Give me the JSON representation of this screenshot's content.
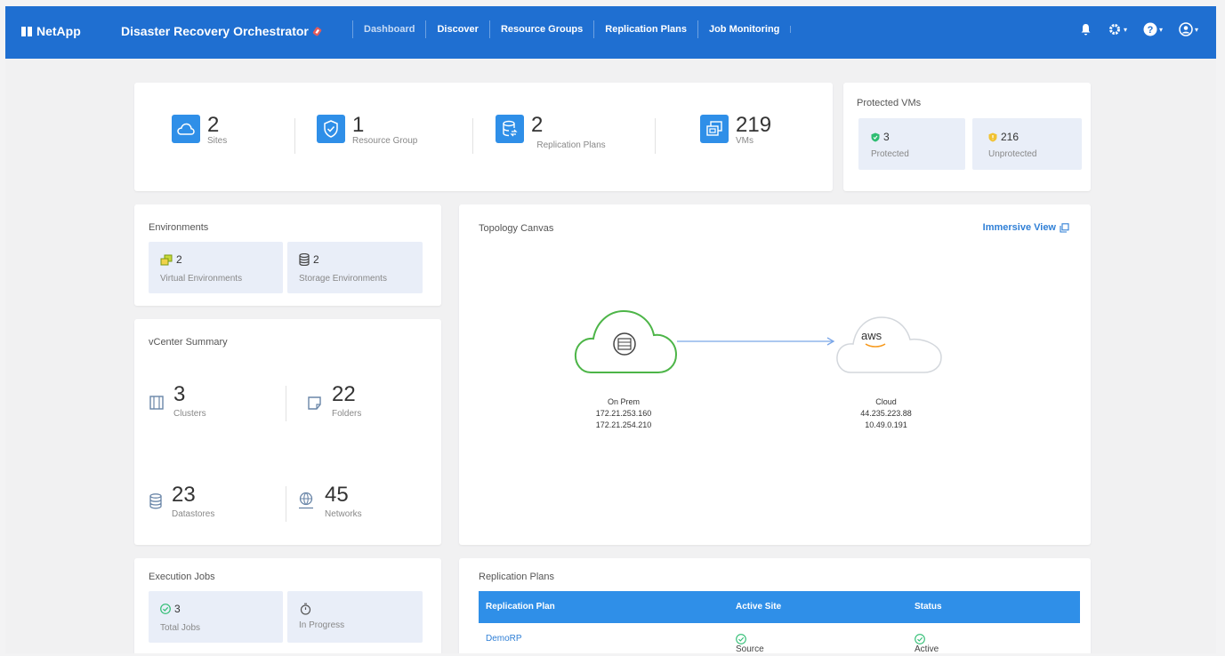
{
  "header": {
    "brand": "NetApp",
    "app_title": "Disaster Recovery Orchestrator",
    "nav": [
      "Dashboard",
      "Discover",
      "Resource Groups",
      "Replication Plans",
      "Job Monitoring"
    ]
  },
  "summary": {
    "sites": {
      "value": "2",
      "label": "Sites"
    },
    "resource_group": {
      "value": "1",
      "label": "Resource Group"
    },
    "replication_plans": {
      "value": "2",
      "label": "Replication Plans"
    },
    "vms": {
      "value": "219",
      "label": "VMs"
    }
  },
  "protected_vms": {
    "title": "Protected VMs",
    "protected": {
      "value": "3",
      "label": "Protected"
    },
    "unprotected": {
      "value": "216",
      "label": "Unprotected"
    }
  },
  "environments": {
    "title": "Environments",
    "virtual": {
      "value": "2",
      "label": "Virtual Environments"
    },
    "storage": {
      "value": "2",
      "label": "Storage Environments"
    }
  },
  "vcenter": {
    "title": "vCenter Summary",
    "clusters": {
      "value": "3",
      "label": "Clusters"
    },
    "folders": {
      "value": "22",
      "label": "Folders"
    },
    "datastores": {
      "value": "23",
      "label": "Datastores"
    },
    "networks": {
      "value": "45",
      "label": "Networks"
    }
  },
  "topology": {
    "title": "Topology Canvas",
    "immersive": "Immersive View",
    "onprem": {
      "name": "On Prem",
      "ip1": "172.21.253.160",
      "ip2": "172.21.254.210"
    },
    "cloud": {
      "name": "Cloud",
      "logo": "aws",
      "ip1": "44.235.223.88",
      "ip2": "10.49.0.191"
    }
  },
  "jobs": {
    "title": "Execution Jobs",
    "total": {
      "value": "3",
      "label": "Total Jobs"
    },
    "progress": {
      "label": "In Progress"
    }
  },
  "replication": {
    "title": "Replication Plans",
    "columns": [
      "Replication Plan",
      "Active Site",
      "Status"
    ],
    "rows": [
      {
        "plan": "DemoRP",
        "site": "Source",
        "status": "Active"
      }
    ]
  },
  "colors": {
    "nav": "#1f6fd1",
    "accent": "#2f8fe8",
    "protected": "#2ebd72",
    "unprotected": "#f1c232"
  }
}
